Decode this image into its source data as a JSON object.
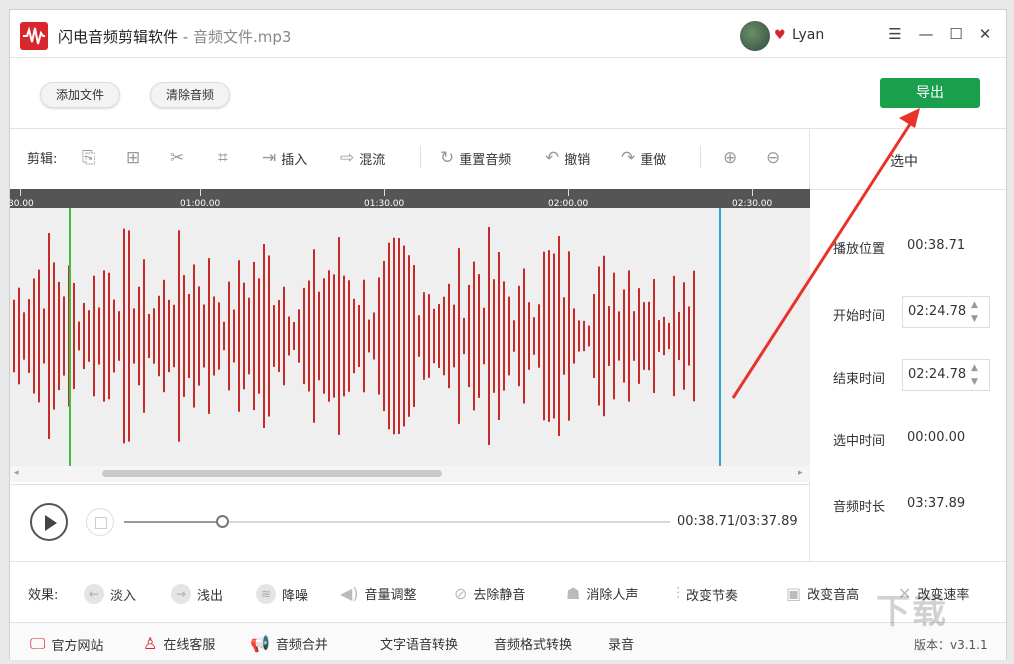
{
  "titlebar": {
    "app_name": "闪电音频剪辑软件",
    "separator": " - ",
    "file_name": "音频文件.mp3",
    "username": "Lyan"
  },
  "top_actions": {
    "add_file": "添加文件",
    "clear_audio": "清除音频",
    "export": "导出"
  },
  "edit_toolbar": {
    "label": "剪辑:",
    "insert": "插入",
    "mix": "混流",
    "reset_audio": "重置音频",
    "undo": "撤销",
    "redo": "重做"
  },
  "timeline": {
    "ticks": [
      "30.00",
      "01:00.00",
      "01:30.00",
      "02:00.00",
      "02:30.00"
    ]
  },
  "playback": {
    "time": "00:38.71/03:37.89",
    "progress_fraction": 0.18
  },
  "selection_panel": {
    "header": "选中",
    "play_position_label": "播放位置",
    "play_position": "00:38.71",
    "start_label": "开始时间",
    "start_value": "02:24.78",
    "end_label": "结束时间",
    "end_value": "02:24.78",
    "selected_label": "选中时间",
    "selected_value": "00:00.00",
    "duration_label": "音频时长",
    "duration_value": "03:37.89"
  },
  "effects": {
    "label": "效果:",
    "items": [
      "淡入",
      "浅出",
      "降噪",
      "音量调整",
      "去除静音",
      "消除人声",
      "改变节奏",
      "改变音高",
      "改变速率"
    ]
  },
  "bottom_bar": {
    "items": [
      "官方网站",
      "在线客服",
      "音频合并",
      "文字语音转换",
      "音频格式转换",
      "录音"
    ],
    "version": "版本：v3.1.1",
    "watermark": "下载"
  },
  "colors": {
    "brand_red": "#d8262e",
    "export_green": "#1aa04c",
    "wave_red": "#c62b2b",
    "playhead_green": "#3cc23c",
    "end_marker_blue": "#2aa4d4",
    "annotation_arrow": "#e8332a"
  }
}
